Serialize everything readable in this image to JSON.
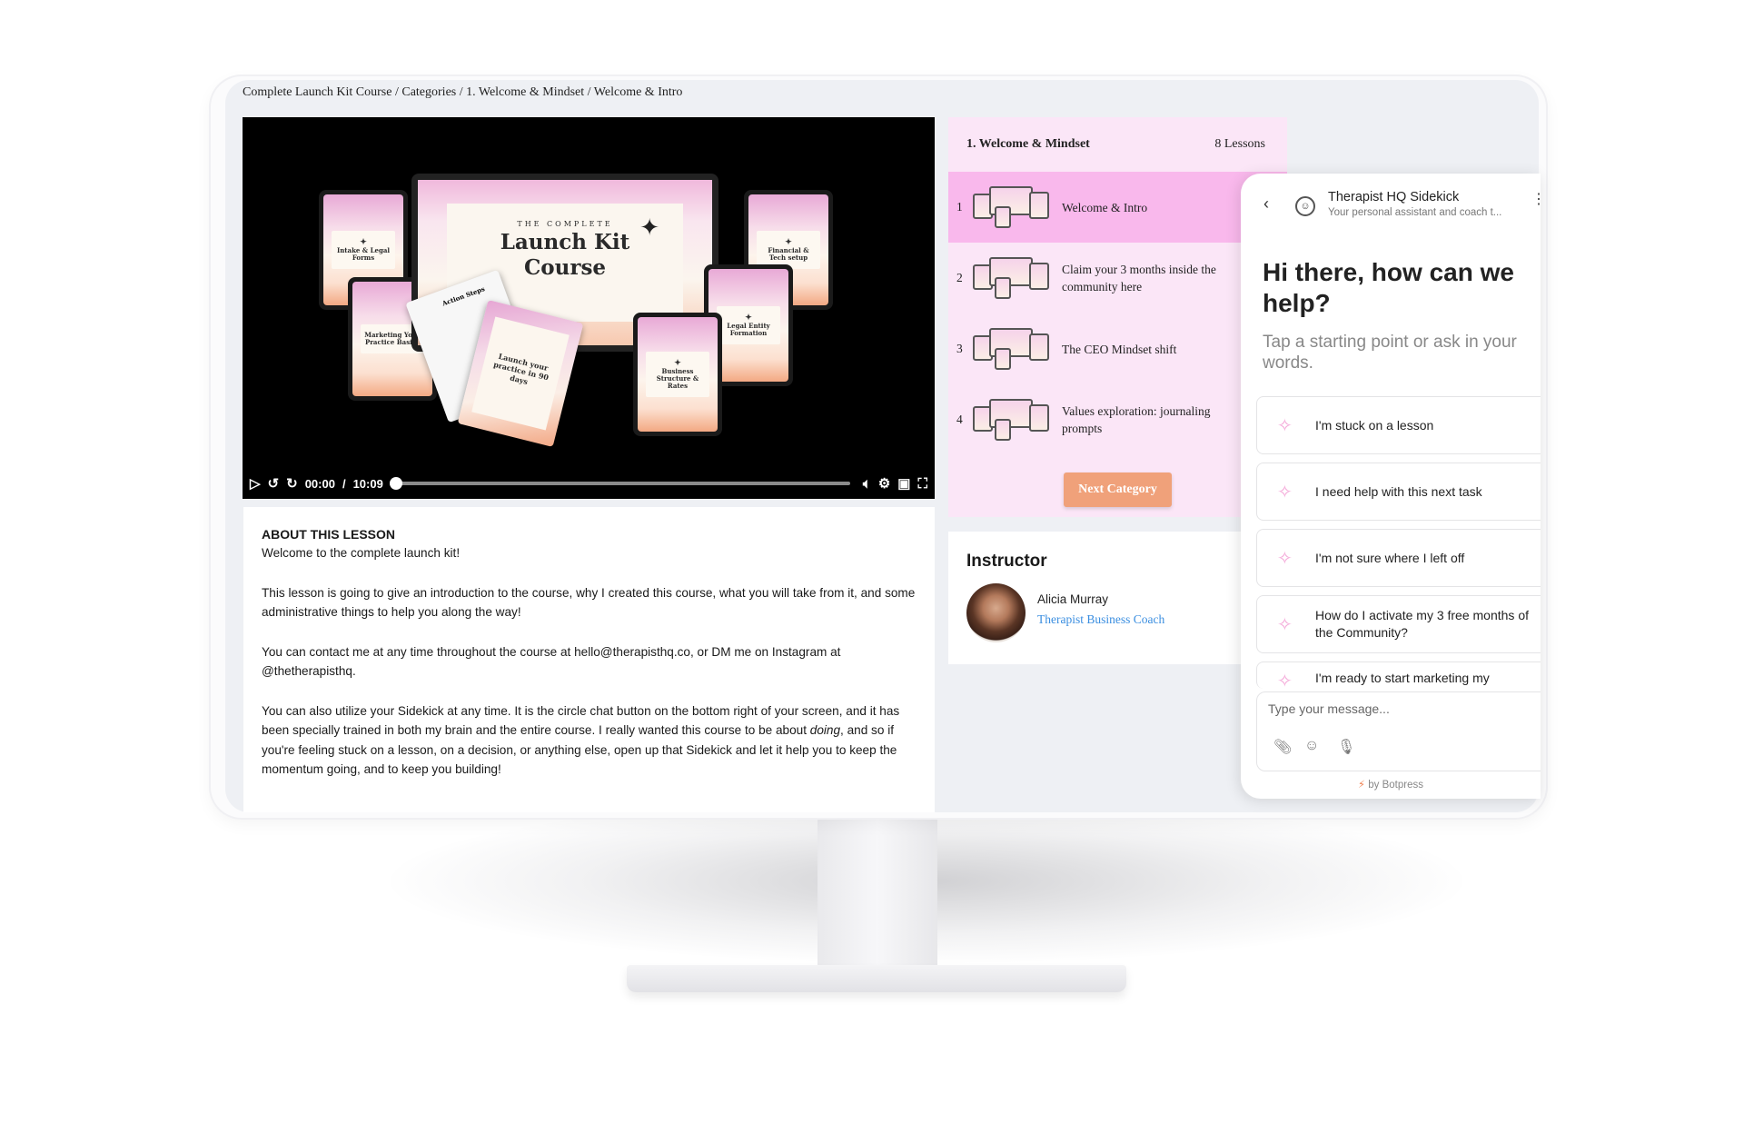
{
  "breadcrumb": "Complete Launch Kit Course / Categories / 1. Welcome & Mindset / Welcome & Intro",
  "video": {
    "current_time": "00:00",
    "separator": "/",
    "duration": "10:09",
    "progress": 0.0,
    "thumbnail": {
      "monitor_small": "THE COMPLETE",
      "monitor_title_1": "Launch Kit",
      "monitor_title_2": "Course",
      "devices": [
        "Intake & Legal Forms",
        "Marketing Your Practice Basics",
        "Financial & Tech setup",
        "Legal Entity Formation",
        "Business Structure & Rates"
      ],
      "paper_white": "Action Steps",
      "paper_pink": "Launch your practice in 90 days"
    }
  },
  "about": {
    "heading": "ABOUT THIS LESSON",
    "intro": "Welcome to the complete launch kit!",
    "p1": "This lesson is going to give an introduction to the course, why I created this course, what you will take from it, and some administrative things to help you along the way!",
    "p2": "You can contact me at any time throughout the course at hello@therapisthq.co, or DM me on Instagram at @thetherapisthq.",
    "p3_before": "You can also utilize your Sidekick at any time. It is the circle chat button on the bottom right of your screen, and it has been specially trained in both my brain and the entire course. I really wanted this course to be about ",
    "p3_em": "doing",
    "p3_after": ", and so if you're feeling stuck on a lesson, on a decision, or anything else, open up that Sidekick and let it help you to keep the momentum going, and to keep you building!"
  },
  "lessons": {
    "category": "1. Welcome & Mindset",
    "count": "8 Lessons",
    "items": [
      {
        "num": "1",
        "title": "Welcome & Intro"
      },
      {
        "num": "2",
        "title": "Claim your 3 months inside the community here"
      },
      {
        "num": "3",
        "title": "The CEO Mindset shift"
      },
      {
        "num": "4",
        "title": "Values exploration: journaling prompts"
      }
    ],
    "next_button": "Next Category"
  },
  "instructor": {
    "heading": "Instructor",
    "name": "Alicia Murray",
    "role": "Therapist Business Coach"
  },
  "chat": {
    "title": "Therapist HQ Sidekick",
    "subtitle": "Your personal assistant and coach t...",
    "greeting": "Hi there, how can we help?",
    "prompt": "Tap a starting point or ask in your words.",
    "suggestions": [
      "I'm stuck on a lesson",
      "I need help with this next task",
      "I'm not sure where I left off",
      "How do I activate my 3 free months of the Community?",
      "I'm ready to start marketing my"
    ],
    "input_placeholder": "Type your message...",
    "footer": "by Botpress"
  },
  "colors": {
    "lesson_panel_bg": "#fbe6f7",
    "lesson_active_bg": "#f9b8ec",
    "next_button_bg": "#f0a17a",
    "link_blue": "#3a8ee0"
  }
}
